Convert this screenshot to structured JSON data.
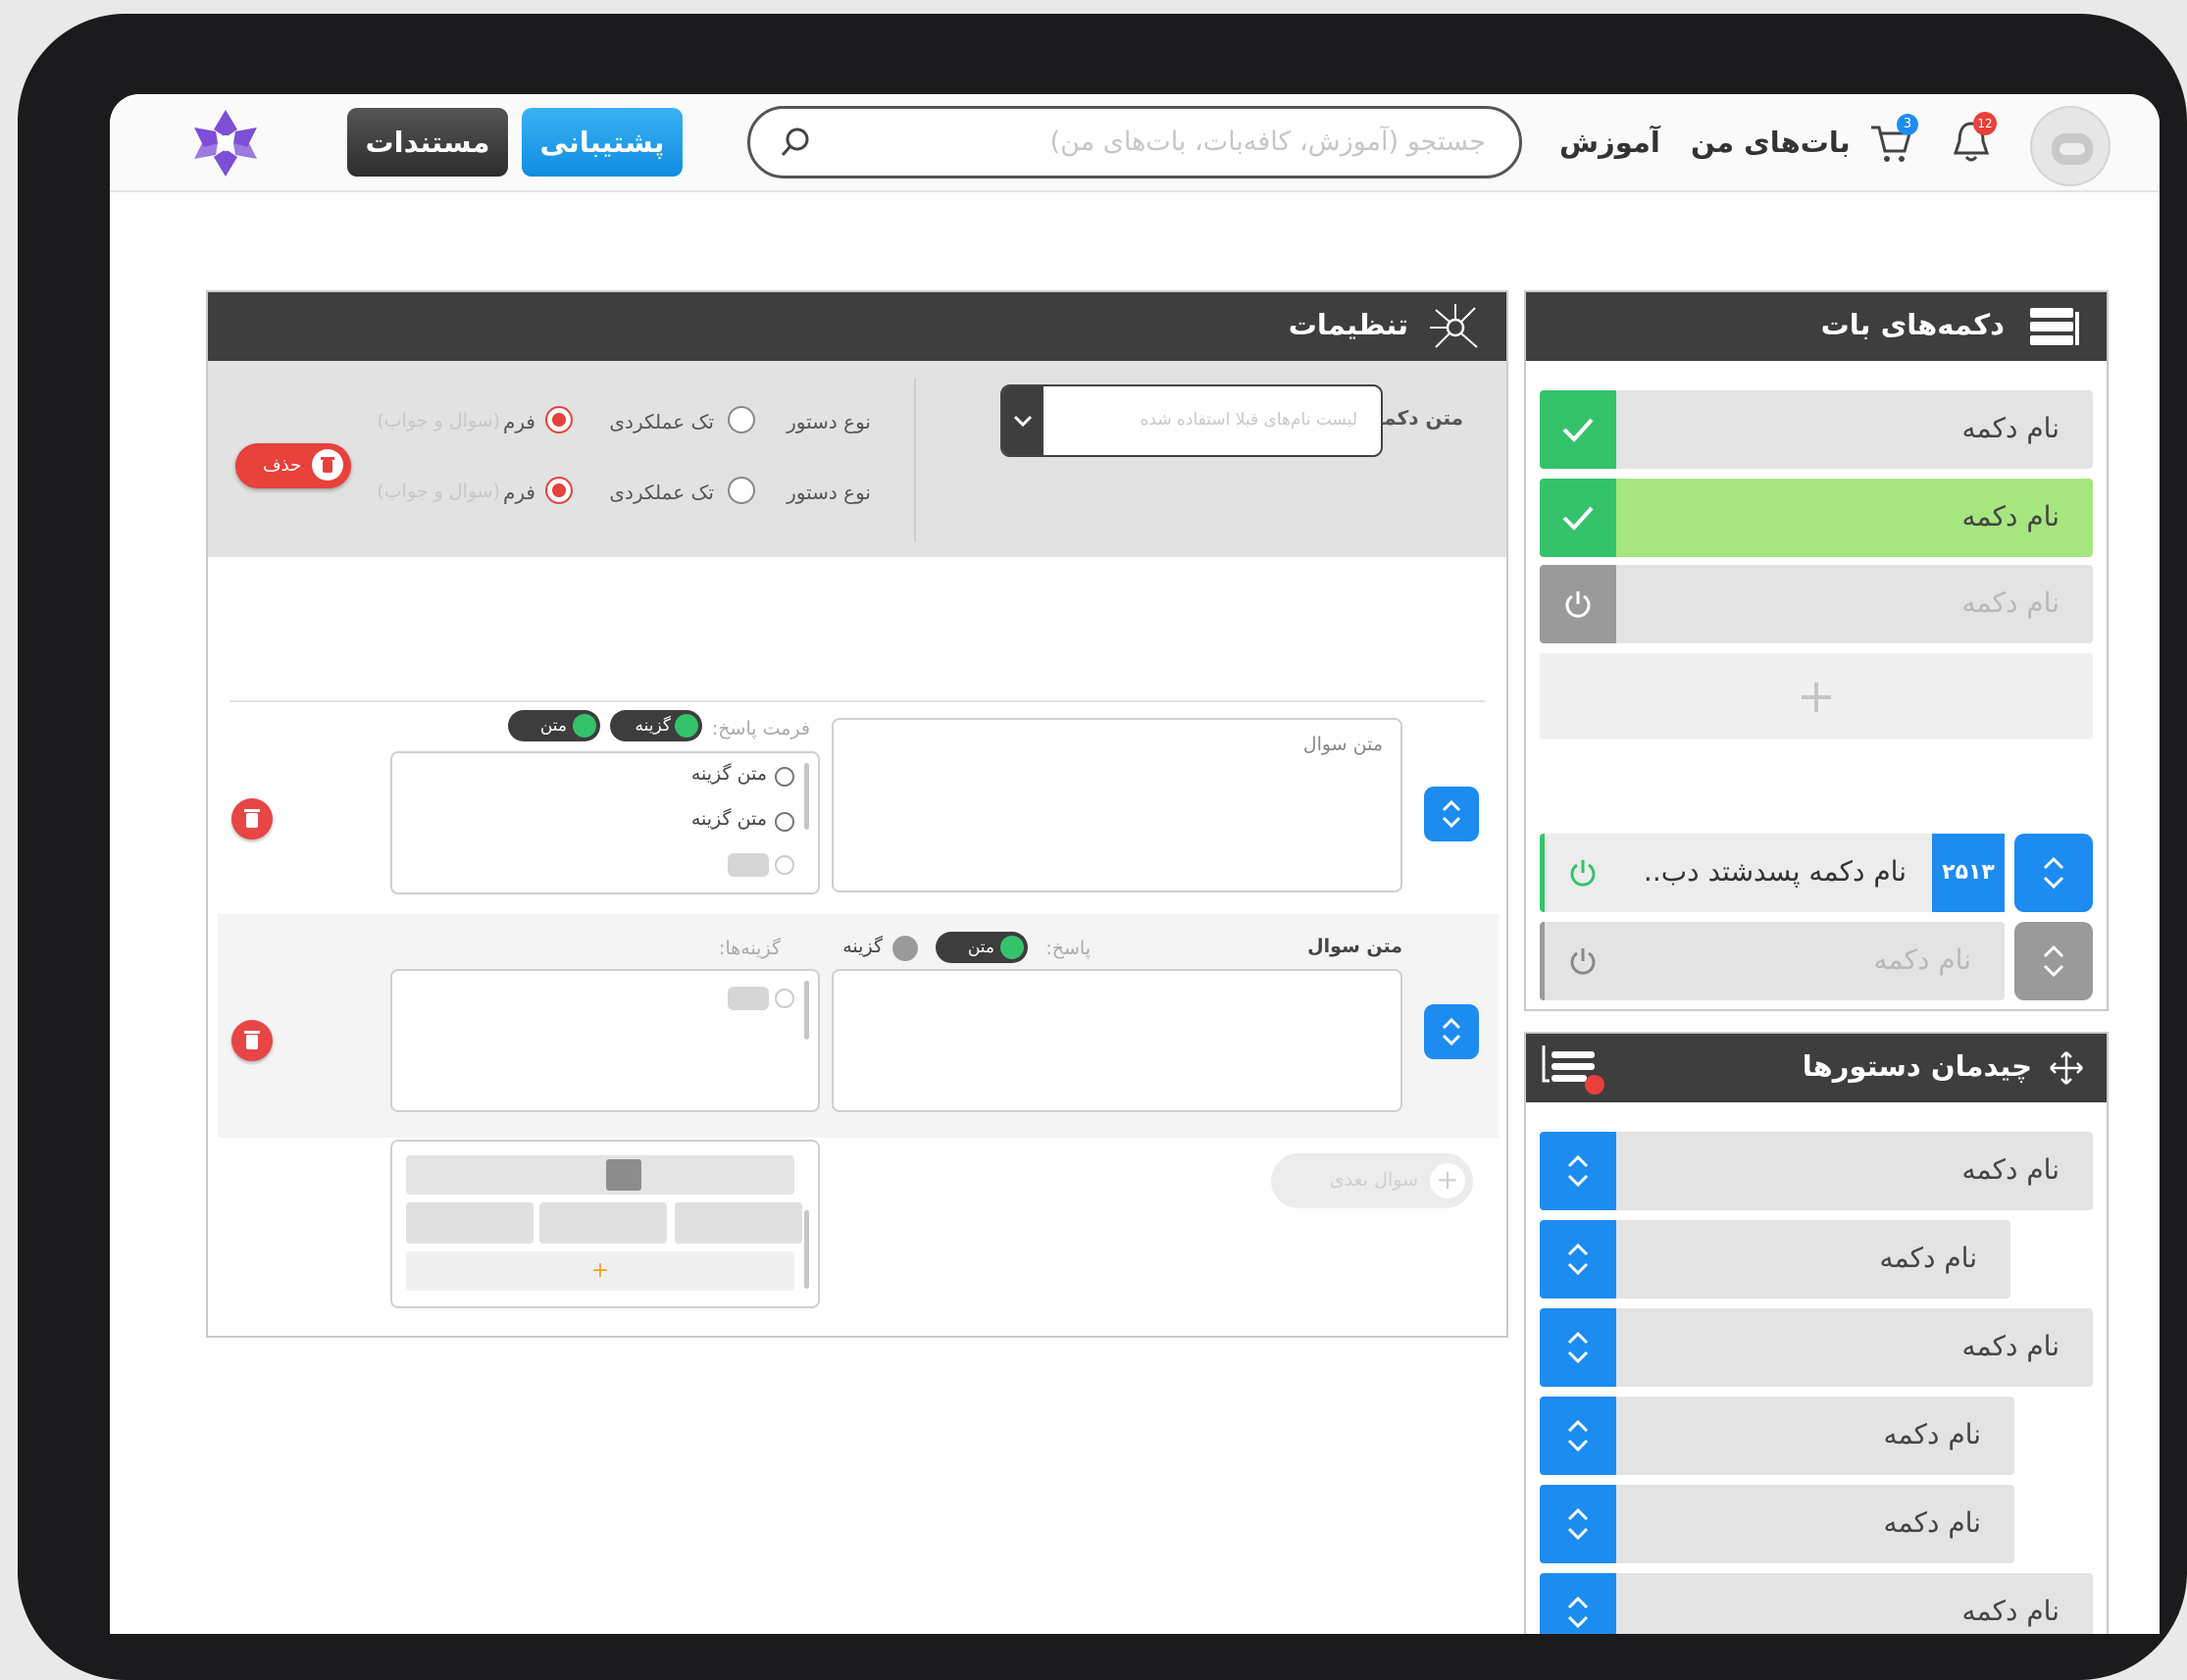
{
  "header": {
    "docs_label": "مستندات",
    "support_label": "پشتیبانی",
    "search_placeholder": "جستجو (آموزش، کافه‌بات، بات‌های من)",
    "nav_learning": "آموزش",
    "nav_my_bots": "بات‌های من",
    "cart_badge": "3",
    "notif_badge": "12"
  },
  "bot_buttons": {
    "title": "دکمه‌های بات",
    "items": [
      {
        "label": "نام دکمه",
        "state": "active"
      },
      {
        "label": "نام دکمه",
        "state": "selected"
      },
      {
        "label": "نام دکمه",
        "state": "disabled"
      }
    ],
    "add_label": "+",
    "list": [
      {
        "label": "نام دکمه پسدشتد دب..",
        "tag": "۲۵۱۳"
      },
      {
        "label": "نام دکمه"
      }
    ]
  },
  "settings": {
    "title": "تنظیمات",
    "button_text_label": "متن دکمه",
    "button_text_placeholder": "لیست نام‌های قبلا استفاده شده",
    "command_type_label": "نوع دستور",
    "single_action": "تک عملکردی",
    "form_label": "فرم",
    "form_hint": "(سوال و جواب)",
    "delete_label": "حذف"
  },
  "questions": {
    "q1": {
      "placeholder": "متن سوال",
      "answer_format": "فرمت پاسخ:",
      "pill_option": "گزینه",
      "pill_text": "متن",
      "options": [
        "متن گزینه",
        "متن گزینه"
      ]
    },
    "q2": {
      "label": "متن سوال",
      "answer": "پاسخ:",
      "pill_text": "متن",
      "option": "گزینه",
      "options_label": "گزینه‌ها:"
    },
    "next_label": "سوال بعدی"
  },
  "arrangement": {
    "title": "چیدمان دستورها",
    "items": [
      "نام دکمه",
      "نام دکمه",
      "نام دکمه",
      "نام دکمه",
      "نام دکمه",
      "نام دکمه"
    ]
  }
}
